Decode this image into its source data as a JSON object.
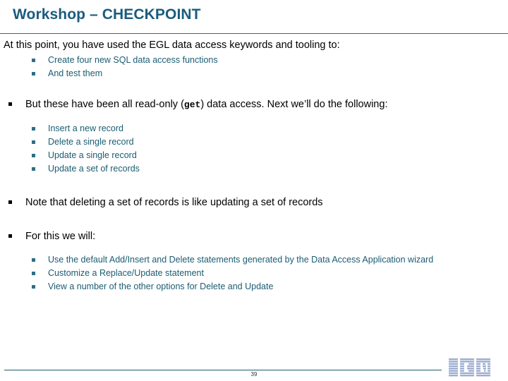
{
  "slide": {
    "title": "Workshop – CHECKPOINT",
    "page_number": "39",
    "accent_color": "#1a5c7d",
    "body_accent_color": "#1a5c72",
    "logo_color": "#9aabd0"
  },
  "content": {
    "intro": "At this point, you have used the EGL data access keywords and tooling to:",
    "intro_sub": [
      "Create four new SQL data access functions",
      "And test them"
    ],
    "readonly": {
      "before": "But these have been all read-only (",
      "code": "get",
      "after": ") data access.  Next we’ll do the following:"
    },
    "readonly_sub": [
      "Insert a new record",
      "Delete a single record",
      "Update a single record",
      "Update a set of records"
    ],
    "note": "Note that deleting a set of records is like updating a set of records",
    "for_this": "For this we will:",
    "for_this_sub": [
      "Use the default Add/Insert and Delete statements generated by the Data Access Application wizard",
      "Customize a Replace/Update statement",
      "View a number of the other options for Delete and Update"
    ]
  },
  "logo": {
    "name": "IBM"
  }
}
